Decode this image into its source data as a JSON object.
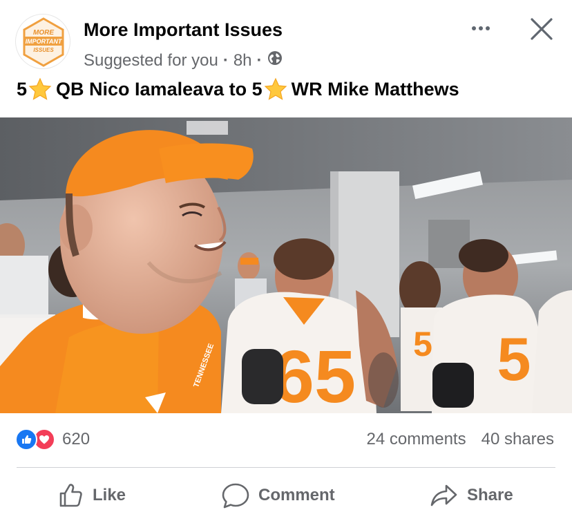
{
  "post": {
    "page_name": "More Important Issues",
    "logo_text": [
      "MORE",
      "IMPORTANT",
      "ISSUES"
    ],
    "meta": {
      "suggested": "Suggested for you",
      "time": "8h",
      "separator": "·",
      "audience_icon": "globe-icon"
    },
    "text": {
      "part1_num": "5",
      "part1": "QB Nico Iamaleava to 5",
      "part2": "WR Mike Matthews",
      "emoji": "star-emoji"
    },
    "photo_jersey_numbers": [
      "65",
      "5"
    ]
  },
  "engagement": {
    "reaction_count": "620",
    "comments": "24 comments",
    "shares": "40 shares"
  },
  "actions": {
    "like": "Like",
    "comment": "Comment",
    "share": "Share"
  },
  "colors": {
    "tennessee_orange": "#f58a1f",
    "facebook_blue": "#1877f2",
    "love_red": "#f33e58",
    "meta_gray": "#65676b"
  }
}
